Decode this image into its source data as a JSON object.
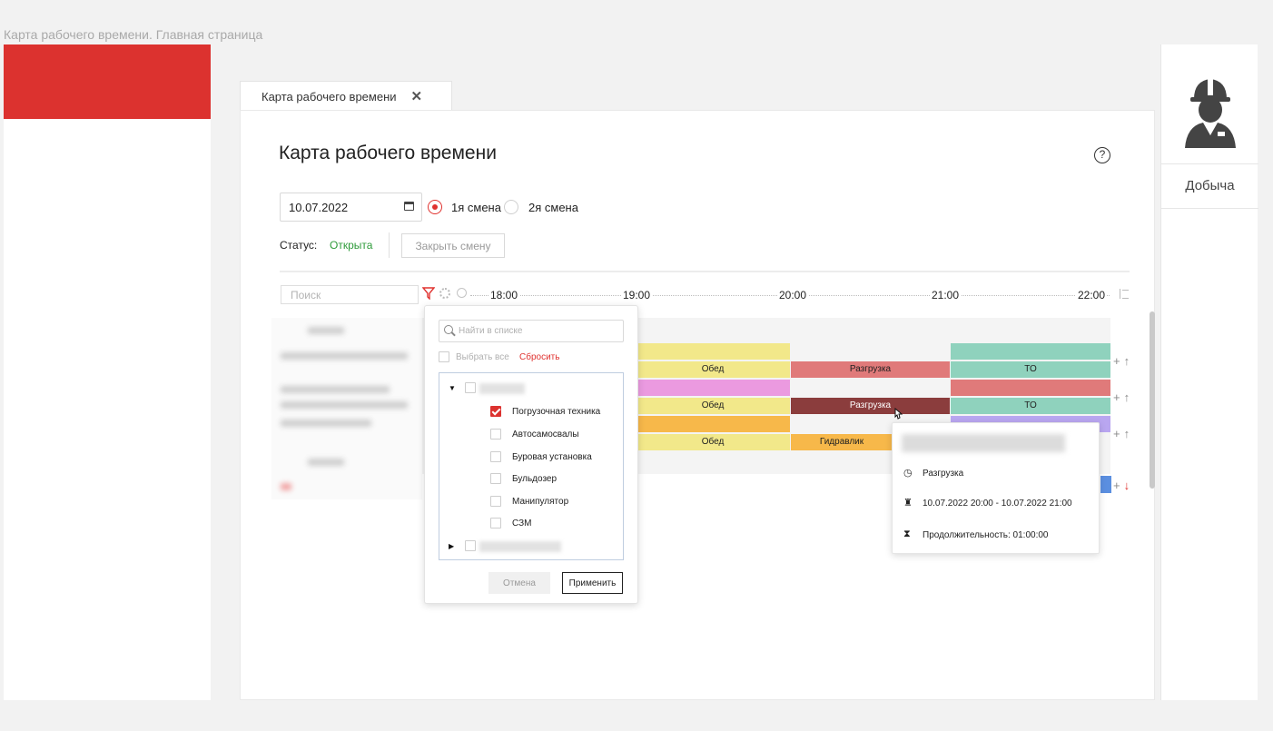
{
  "page_caption": "Карта рабочего времени. Главная страница",
  "tab": {
    "label": "Карта рабочего времени",
    "close": "✕"
  },
  "header": {
    "title": "Карта рабочего времени",
    "help": "?"
  },
  "controls": {
    "date": "10.07.2022",
    "shift1": "1я смена",
    "shift2": "2я смена",
    "status_label": "Статус:",
    "status_value": "Открыта",
    "close_shift": "Закрыть смену",
    "search_placeholder": "Поиск"
  },
  "timeline": {
    "times": [
      "18:00",
      "19:00",
      "20:00",
      "21:00",
      "22:00"
    ]
  },
  "segments": {
    "r1_lunch": "Обед",
    "r1_unload": "Разгрузка",
    "r1_to": "ТО",
    "r2_lunch": "Обед",
    "r2_unload": "Разгрузка",
    "r2_to": "ТО",
    "r3_lunch": "Обед",
    "r3_hydraulics": "Гидравлик"
  },
  "row_actions": {
    "plus": "+",
    "up": "↑",
    "down": "↓"
  },
  "filter_popup": {
    "search_placeholder": "Найти в списке",
    "select_all": "Выбрать все",
    "reset": "Сбросить",
    "items": [
      "Погрузочная техника",
      "Автосамосвалы",
      "Буровая установка",
      "Бульдозер",
      "Манипулятор",
      "СЗМ"
    ],
    "cancel": "Отмена",
    "apply": "Применить"
  },
  "tooltip": {
    "activity": "Разгрузка",
    "interval": "10.07.2022 20:00 - 10.07.2022 21:00",
    "duration": "Продолжительность: 01:00:00"
  },
  "right_panel": {
    "label": "Добыча"
  },
  "colors": {
    "brand_red": "#dc322f",
    "status_green": "#2e9b3a",
    "lunch": "#f2e88a",
    "unload": "#e07a7a",
    "unload_active": "#8b3d3d",
    "to": "#8fd2bd",
    "pink": "#eb9ae0",
    "orange": "#f7b84a",
    "lavender": "#b9a6f0"
  }
}
